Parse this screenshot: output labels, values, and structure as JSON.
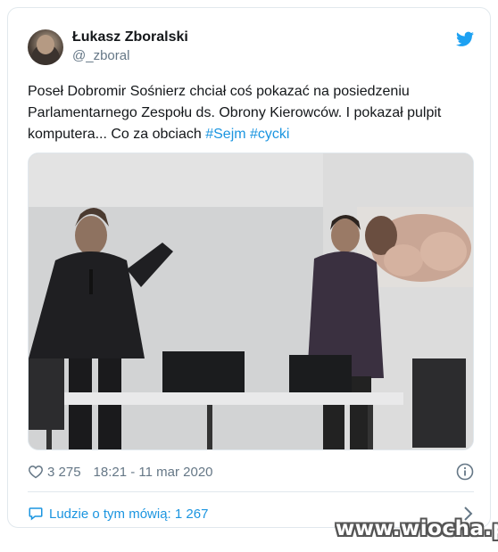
{
  "tweet": {
    "author_name": "Łukasz Zboralski",
    "author_handle": "@_zboral",
    "text_main": "Poseł Dobromir Sośnierz chciał coś pokazać na posiedzeniu Parlamentarnego Zespołu ds. Obrony Kierowców. I pokazał pulpit komputera... Co za obciach ",
    "hashtags": [
      "#Sejm",
      "#cycki"
    ],
    "likes": "3 275",
    "timestamp": "18:21 - 11 mar 2020",
    "people_talking": "Ludzie o tym mówią: 1 267"
  },
  "icons": {
    "brand": "twitter-bird-icon",
    "like": "heart-icon",
    "info": "info-icon",
    "people": "speech-bubble-icon",
    "chevron": "chevron-right-icon"
  },
  "colors": {
    "link": "#1b95e0",
    "muted": "#657786",
    "text": "#14171a",
    "border": "#e1e8ed"
  },
  "watermark": "www.wiocha.pl"
}
